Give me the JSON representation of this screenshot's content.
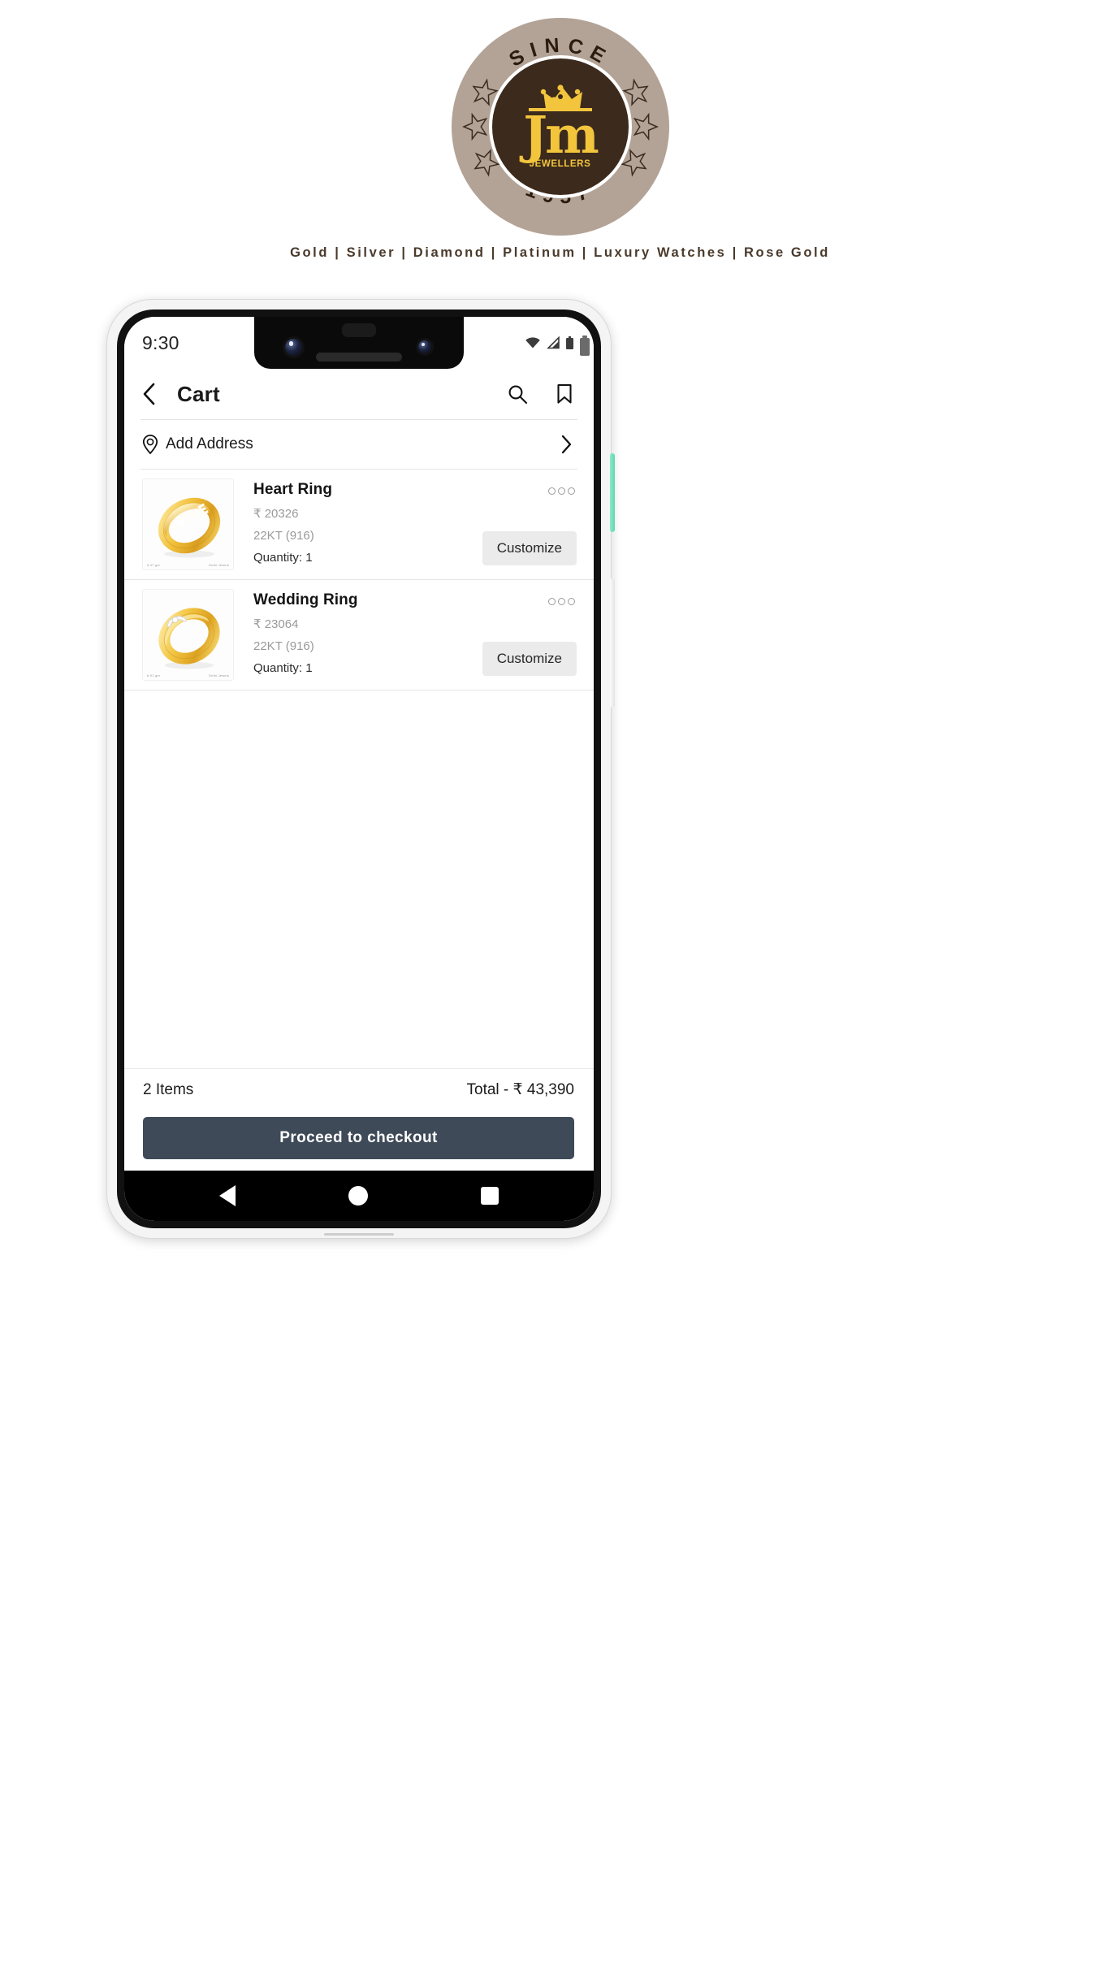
{
  "brand": {
    "logo": {
      "top_arc_text": "SINCE",
      "bottom_arc_text": "1937",
      "monogram": "Jm",
      "sub_text": "JEWELLERS",
      "icon": "crown-icon",
      "star_icon": "star-icon",
      "outer_ring_color": "#b3a396",
      "inner_disc_color": "#3c2a1c",
      "gold_color": "#f2c53d"
    },
    "tagline": "Gold | Silver | Diamond | Platinum | Luxury Watches | Rose Gold"
  },
  "phone": {
    "power_button_color": "#6fdfb8",
    "volume_button_color": "#f0f0f0"
  },
  "statusbar": {
    "time": "9:30",
    "icons": [
      "wifi-icon",
      "signal-icon",
      "battery-icon"
    ]
  },
  "appbar": {
    "back_icon": "chevron-left-icon",
    "title": "Cart",
    "search_icon": "search-icon",
    "bookmark_icon": "bookmark-icon"
  },
  "address": {
    "pin_icon": "location-pin-icon",
    "label": "Add Address",
    "chevron_icon": "chevron-right-icon"
  },
  "cart": {
    "items": [
      {
        "name": "Heart Ring",
        "price": "₹ 20326",
        "karat": "22KT (916)",
        "quantity": "Quantity: 1",
        "image_alt": "gold-love-ring",
        "watermark_left": "6.47 gm",
        "watermark_right": "Delhi Jewels",
        "menu_icon": "more-options-icon",
        "action_label": "Customize"
      },
      {
        "name": "Wedding Ring",
        "price": "₹ 23064",
        "karat": "22KT (916)",
        "quantity": "Quantity: 1",
        "image_alt": "gold-wedding-band-ring",
        "watermark_left": "6.91 gm",
        "watermark_right": "Delhi Jewels",
        "menu_icon": "more-options-icon",
        "action_label": "Customize"
      }
    ]
  },
  "summary": {
    "items_count": "2 Items",
    "total": "Total - ₹ 43,390",
    "checkout_label": "Proceed to checkout",
    "checkout_color": "#3e4a58"
  },
  "navbar": {
    "back_icon": "triangle-back-icon",
    "home_icon": "circle-home-icon",
    "recents_icon": "square-recents-icon"
  }
}
